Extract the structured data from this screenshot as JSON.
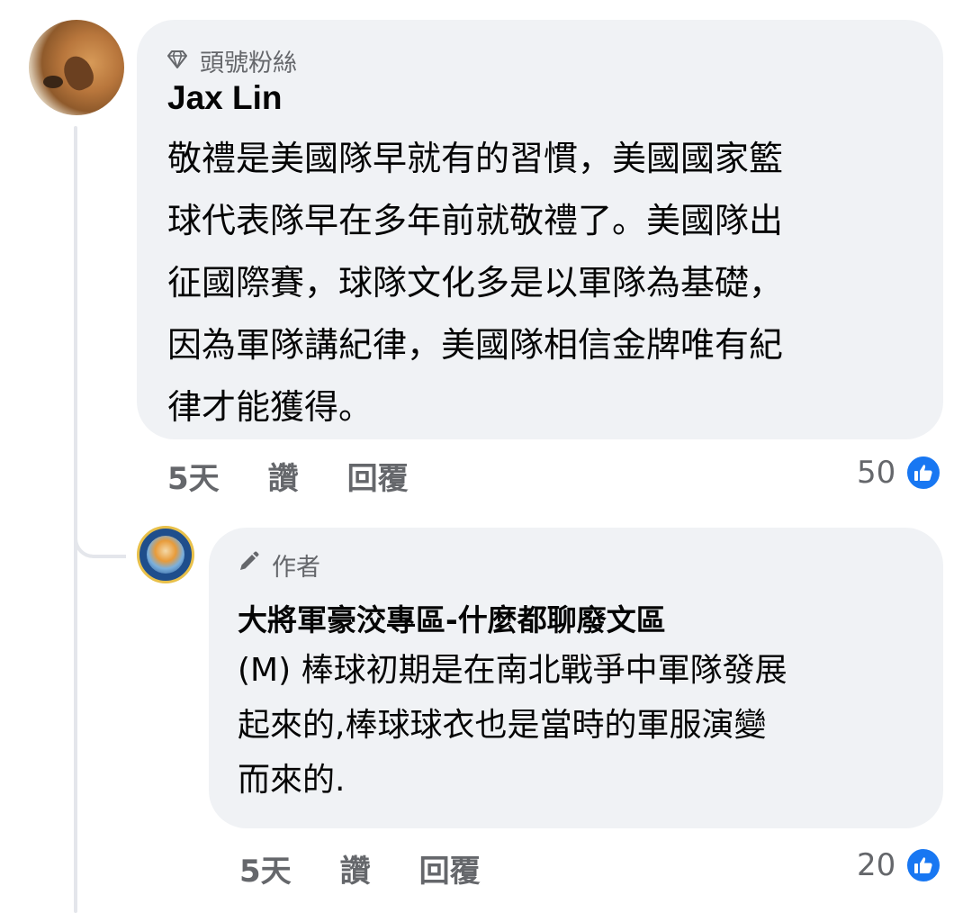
{
  "comment": {
    "badge_icon": "diamond-icon",
    "badge_label": "頭號粉絲",
    "author": "Jax Lin",
    "text": "敬禮是美國隊早就有的習慣，美國國家籃\n球代表隊早在多年前就敬禮了。美國隊出\n征國際賽，球隊文化多是以軍隊為基礎，\n因為軍隊講紀律，美國隊相信金牌唯有紀\n律才能獲得。",
    "time": "5天",
    "like_label": "讚",
    "reply_label": "回覆",
    "reaction_count": "50",
    "reaction_icon": "thumbs-up-icon"
  },
  "reply": {
    "badge_icon": "pencil-icon",
    "badge_label": "作者",
    "author": "大將軍豪洨專區-什麼都聊廢文區",
    "text": "(M) 棒球初期是在南北戰爭中軍隊發展\n起來的,棒球球衣也是當時的軍服演變\n而來的.",
    "time": "5天",
    "like_label": "讚",
    "reply_label": "回覆",
    "reaction_count": "20",
    "reaction_icon": "thumbs-up-icon"
  },
  "colors": {
    "bubble": "#f0f2f5",
    "secondary_text": "#65676b",
    "like_blue": "#1877f2",
    "thread_line": "#e4e6eb"
  }
}
